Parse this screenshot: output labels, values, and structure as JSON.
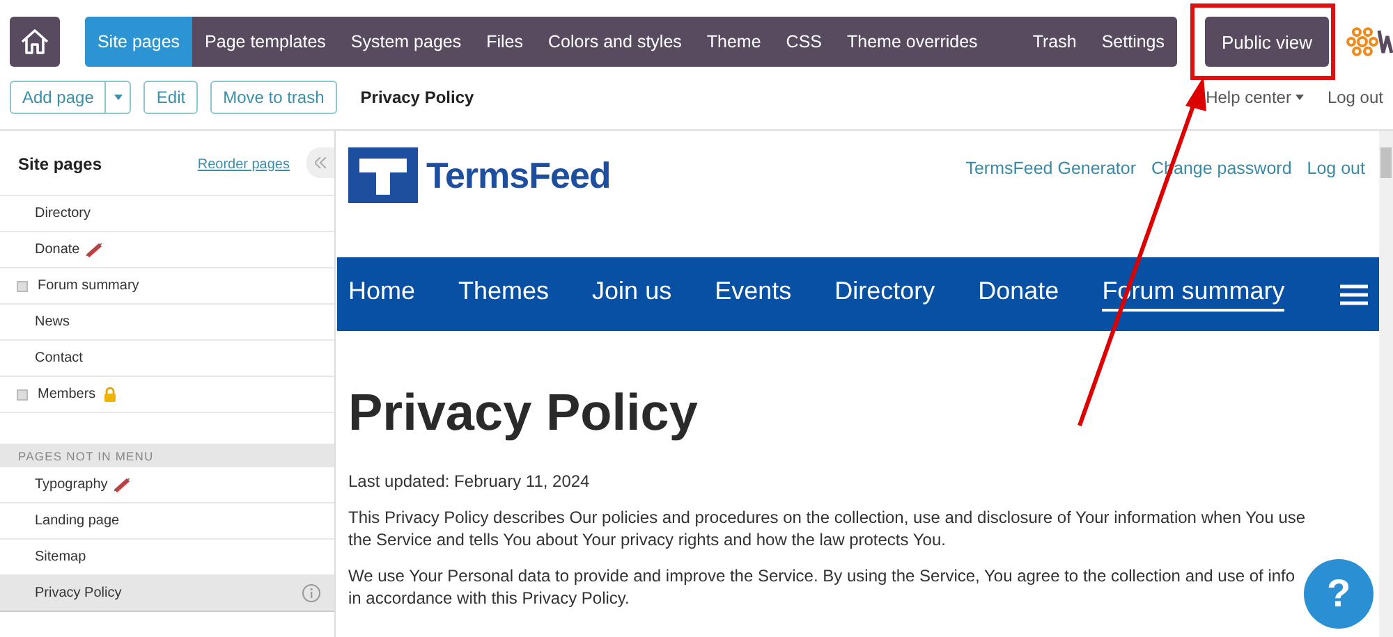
{
  "top_nav": {
    "tabs": [
      {
        "label": "Site pages",
        "selected": true
      },
      {
        "label": "Page templates",
        "selected": false
      },
      {
        "label": "System pages",
        "selected": false
      },
      {
        "label": "Files",
        "selected": false
      },
      {
        "label": "Colors and styles",
        "selected": false
      },
      {
        "label": "Theme",
        "selected": false
      },
      {
        "label": "CSS",
        "selected": false
      },
      {
        "label": "Theme overrides",
        "selected": false
      }
    ],
    "right_tabs": [
      {
        "label": "Trash",
        "selected": false
      },
      {
        "label": "Settings",
        "selected": false
      }
    ],
    "public_view": "Public view"
  },
  "toolbar": {
    "add_page": "Add page",
    "edit": "Edit",
    "move_to_trash": "Move to trash",
    "page_title": "Privacy Policy",
    "help_center": "Help center",
    "log_out": "Log out"
  },
  "sidebar": {
    "title": "Site pages",
    "reorder": "Reorder pages",
    "items": [
      {
        "label": "Directory",
        "expandable": false,
        "selected": false
      },
      {
        "label": "Donate",
        "expandable": false,
        "kind": "hidden",
        "selected": false
      },
      {
        "label": "Forum summary",
        "expandable": true,
        "selected": false
      },
      {
        "label": "News",
        "expandable": false,
        "selected": false
      },
      {
        "label": "Contact",
        "expandable": false,
        "selected": false
      },
      {
        "label": "Members",
        "expandable": true,
        "kind": "locked",
        "selected": false
      }
    ],
    "section": "PAGES NOT IN MENU",
    "hidden_items": [
      {
        "label": "Typography",
        "expandable": false,
        "kind": "hidden",
        "selected": false
      },
      {
        "label": "Landing page",
        "expandable": false,
        "selected": false
      },
      {
        "label": "Sitemap",
        "expandable": false,
        "selected": false
      },
      {
        "label": "Privacy Policy",
        "expandable": false,
        "selected": true
      }
    ]
  },
  "site": {
    "logo": "TermsFeed",
    "links": [
      "TermsFeed Generator",
      "Change password",
      "Log out"
    ],
    "menu": [
      {
        "label": "Home",
        "selected": false
      },
      {
        "label": "Themes",
        "selected": false
      },
      {
        "label": "Join us",
        "selected": false
      },
      {
        "label": "Events",
        "selected": false
      },
      {
        "label": "Directory",
        "selected": false
      },
      {
        "label": "Donate",
        "selected": false
      },
      {
        "label": "Forum summary",
        "selected": true
      }
    ],
    "heading": "Privacy Policy",
    "paragraphs": [
      "Last updated: February 11, 2024",
      "This Privacy Policy describes Our policies and procedures on the collection, use and disclosure of Your information when You use the Service and tells You about Your privacy rights and how the law protects You.",
      "We use Your Personal data to provide and improve the Service. By using the Service, You agree to the collection and use of info in accordance with this Privacy Policy."
    ],
    "help_button": "?"
  }
}
